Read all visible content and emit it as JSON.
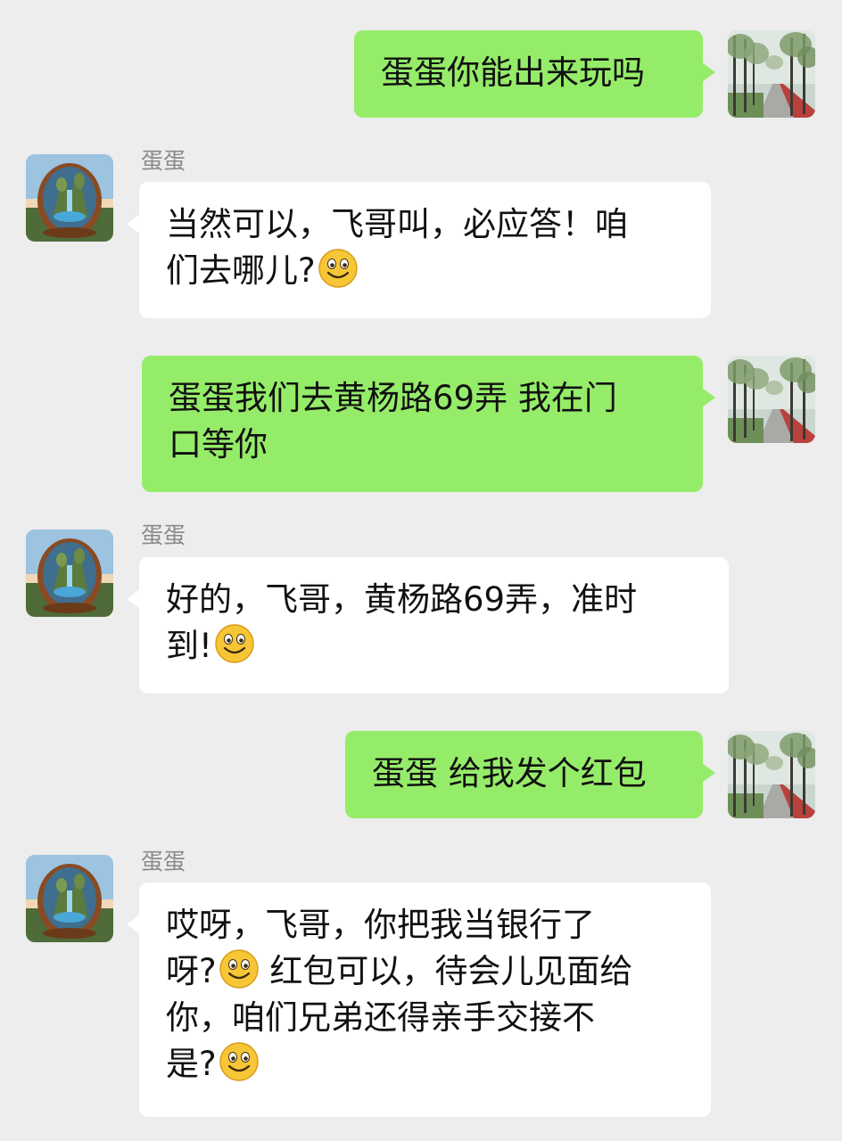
{
  "contact": {
    "name": "蛋蛋"
  },
  "emoji": {
    "smile": "smile-emoji"
  },
  "colors": {
    "my_bubble": "#95ec69",
    "their_bubble": "#ffffff",
    "background": "#ededed",
    "name_text": "#8a8a8a"
  },
  "messages": [
    {
      "from": "me",
      "lines": [
        "蛋蛋你能出来玩吗"
      ]
    },
    {
      "from": "them",
      "sender": "蛋蛋",
      "lines": [
        "当然可以，飞哥叫，必应答！咱",
        "们去哪儿?"
      ]
    },
    {
      "from": "me",
      "lines": [
        "蛋蛋我们去黄杨路69弄 我在门",
        "口等你"
      ]
    },
    {
      "from": "them",
      "sender": "蛋蛋",
      "lines": [
        "好的，飞哥，黄杨路69弄，准时",
        "到!"
      ]
    },
    {
      "from": "me",
      "lines": [
        "蛋蛋 给我发个红包"
      ]
    },
    {
      "from": "them",
      "sender": "蛋蛋",
      "lines": [
        "哎呀，飞哥，你把我当银行了",
        "呀?",
        " 红包可以，待会儿见面给",
        "你，咱们兄弟还得亲手交接不",
        "是?"
      ]
    }
  ]
}
